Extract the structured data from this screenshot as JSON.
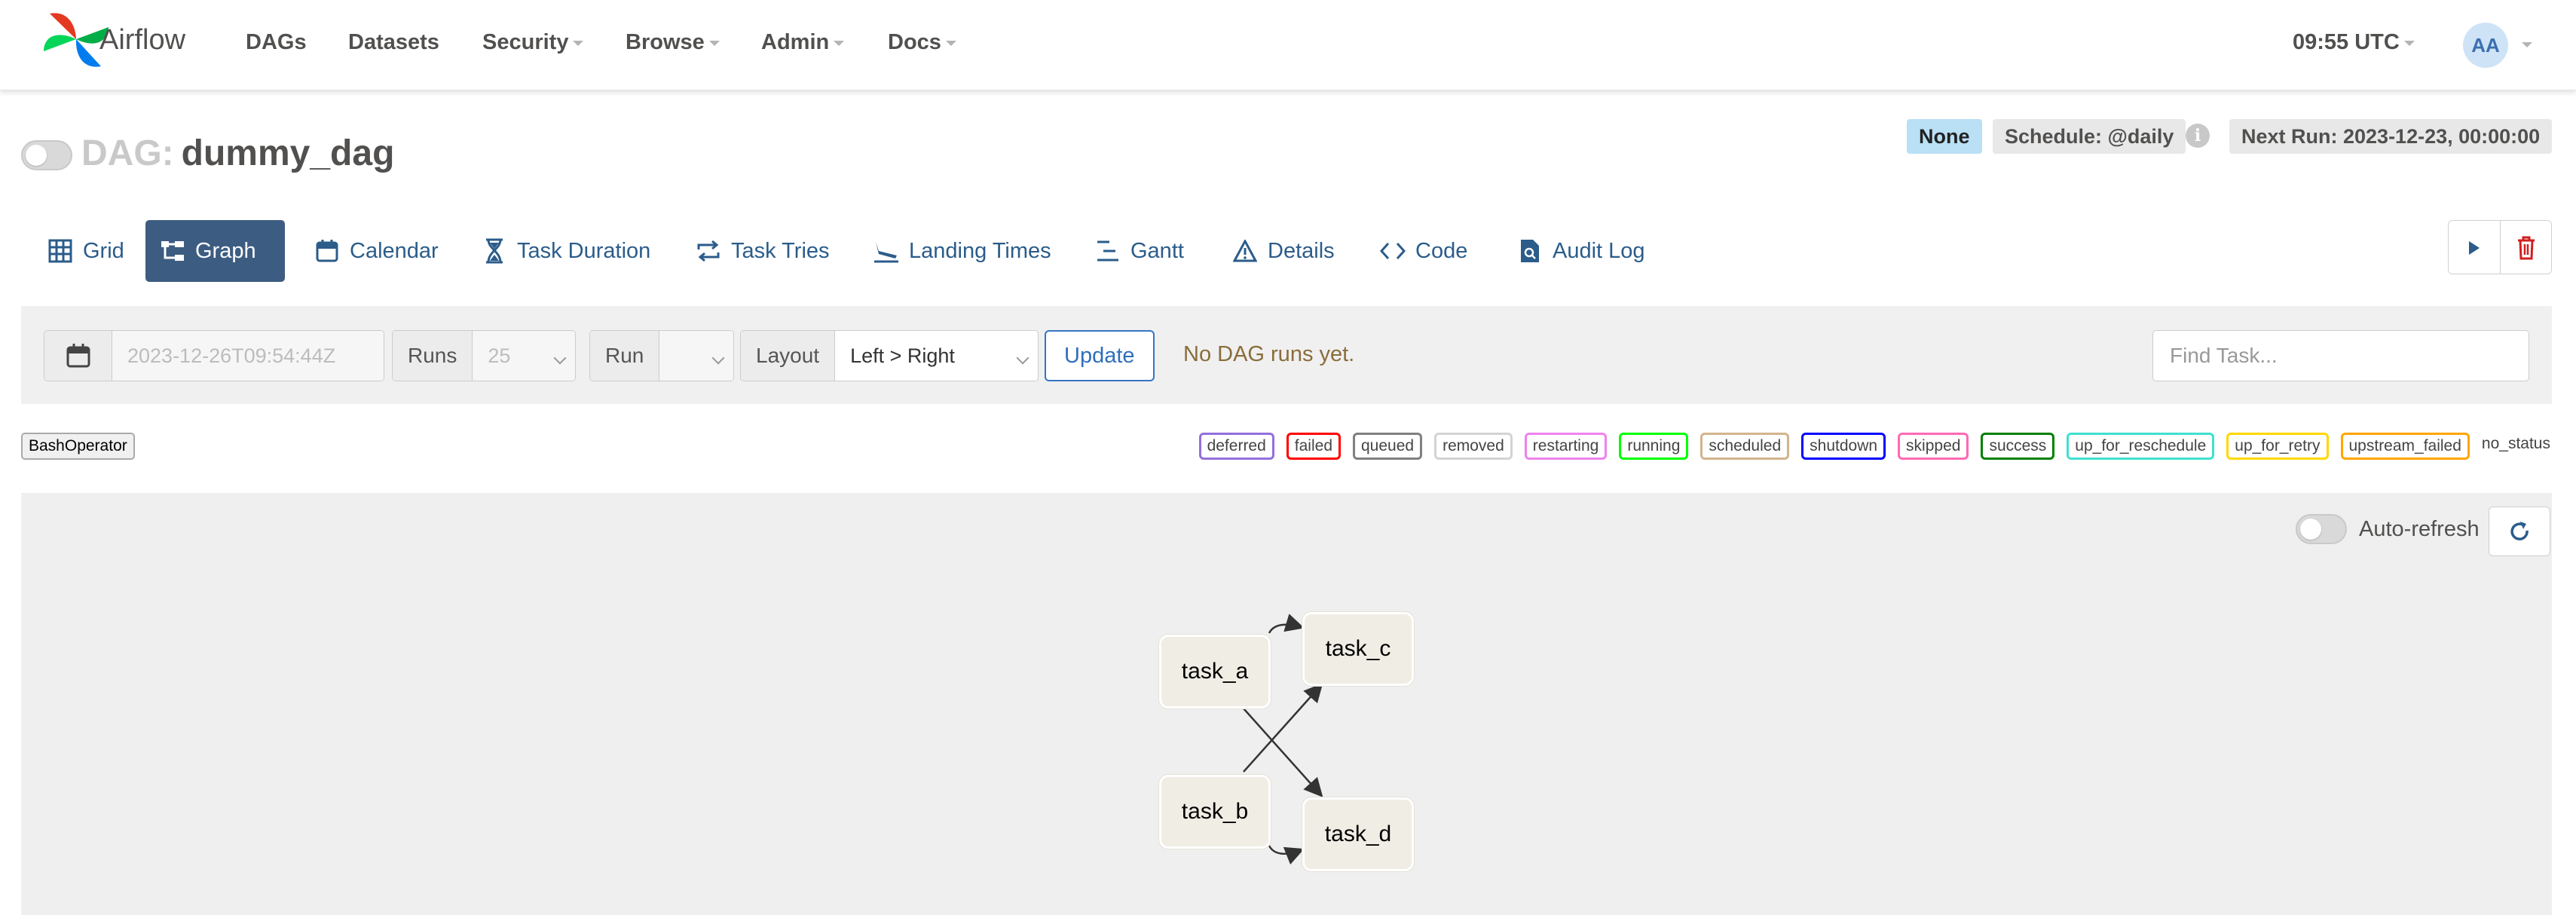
{
  "app": {
    "name": "Airflow"
  },
  "nav": {
    "dags": "DAGs",
    "datasets": "Datasets",
    "security": "Security",
    "browse": "Browse",
    "admin": "Admin",
    "docs": "Docs"
  },
  "header": {
    "clock": "09:55 UTC",
    "user_initials": "AA"
  },
  "dag": {
    "prefix": "DAG:",
    "name": "dummy_dag",
    "badge_none": "None",
    "schedule": "Schedule: @daily",
    "next_run": "Next Run: 2023-12-23, 00:00:00"
  },
  "tabs": [
    {
      "label": "Grid",
      "icon": "grid-icon"
    },
    {
      "label": "Graph",
      "icon": "graph-icon"
    },
    {
      "label": "Calendar",
      "icon": "calendar-icon"
    },
    {
      "label": "Task Duration",
      "icon": "hourglass-icon"
    },
    {
      "label": "Task Tries",
      "icon": "retry-icon"
    },
    {
      "label": "Landing Times",
      "icon": "plane-landing-icon"
    },
    {
      "label": "Gantt",
      "icon": "gantt-icon"
    },
    {
      "label": "Details",
      "icon": "warning-triangle-icon"
    },
    {
      "label": "Code",
      "icon": "code-icon"
    },
    {
      "label": "Audit Log",
      "icon": "file-search-icon"
    }
  ],
  "filters": {
    "date_value": "2023-12-26T09:54:44Z",
    "runs_label": "Runs",
    "runs_value": "25",
    "run_label": "Run",
    "run_value": "",
    "layout_label": "Layout",
    "layout_value": "Left > Right",
    "update_label": "Update",
    "no_runs": "No DAG runs yet.",
    "find_placeholder": "Find Task..."
  },
  "operators": [
    "BashOperator"
  ],
  "states": [
    {
      "label": "deferred",
      "color": "#9370db"
    },
    {
      "label": "failed",
      "color": "#ff0000"
    },
    {
      "label": "queued",
      "color": "#808080"
    },
    {
      "label": "removed",
      "color": "#d3d3d3"
    },
    {
      "label": "restarting",
      "color": "#ee82ee"
    },
    {
      "label": "running",
      "color": "#00ff00"
    },
    {
      "label": "scheduled",
      "color": "#d2b48c"
    },
    {
      "label": "shutdown",
      "color": "#0000ff"
    },
    {
      "label": "skipped",
      "color": "#ff69b4"
    },
    {
      "label": "success",
      "color": "#008000"
    },
    {
      "label": "up_for_reschedule",
      "color": "#40e0d0"
    },
    {
      "label": "up_for_retry",
      "color": "#ffd700"
    },
    {
      "label": "upstream_failed",
      "color": "#ffa500"
    },
    {
      "label": "no_status",
      "color": ""
    }
  ],
  "graph": {
    "autorefresh_label": "Auto-refresh",
    "tasks": {
      "a": "task_a",
      "b": "task_b",
      "c": "task_c",
      "d": "task_d"
    }
  }
}
